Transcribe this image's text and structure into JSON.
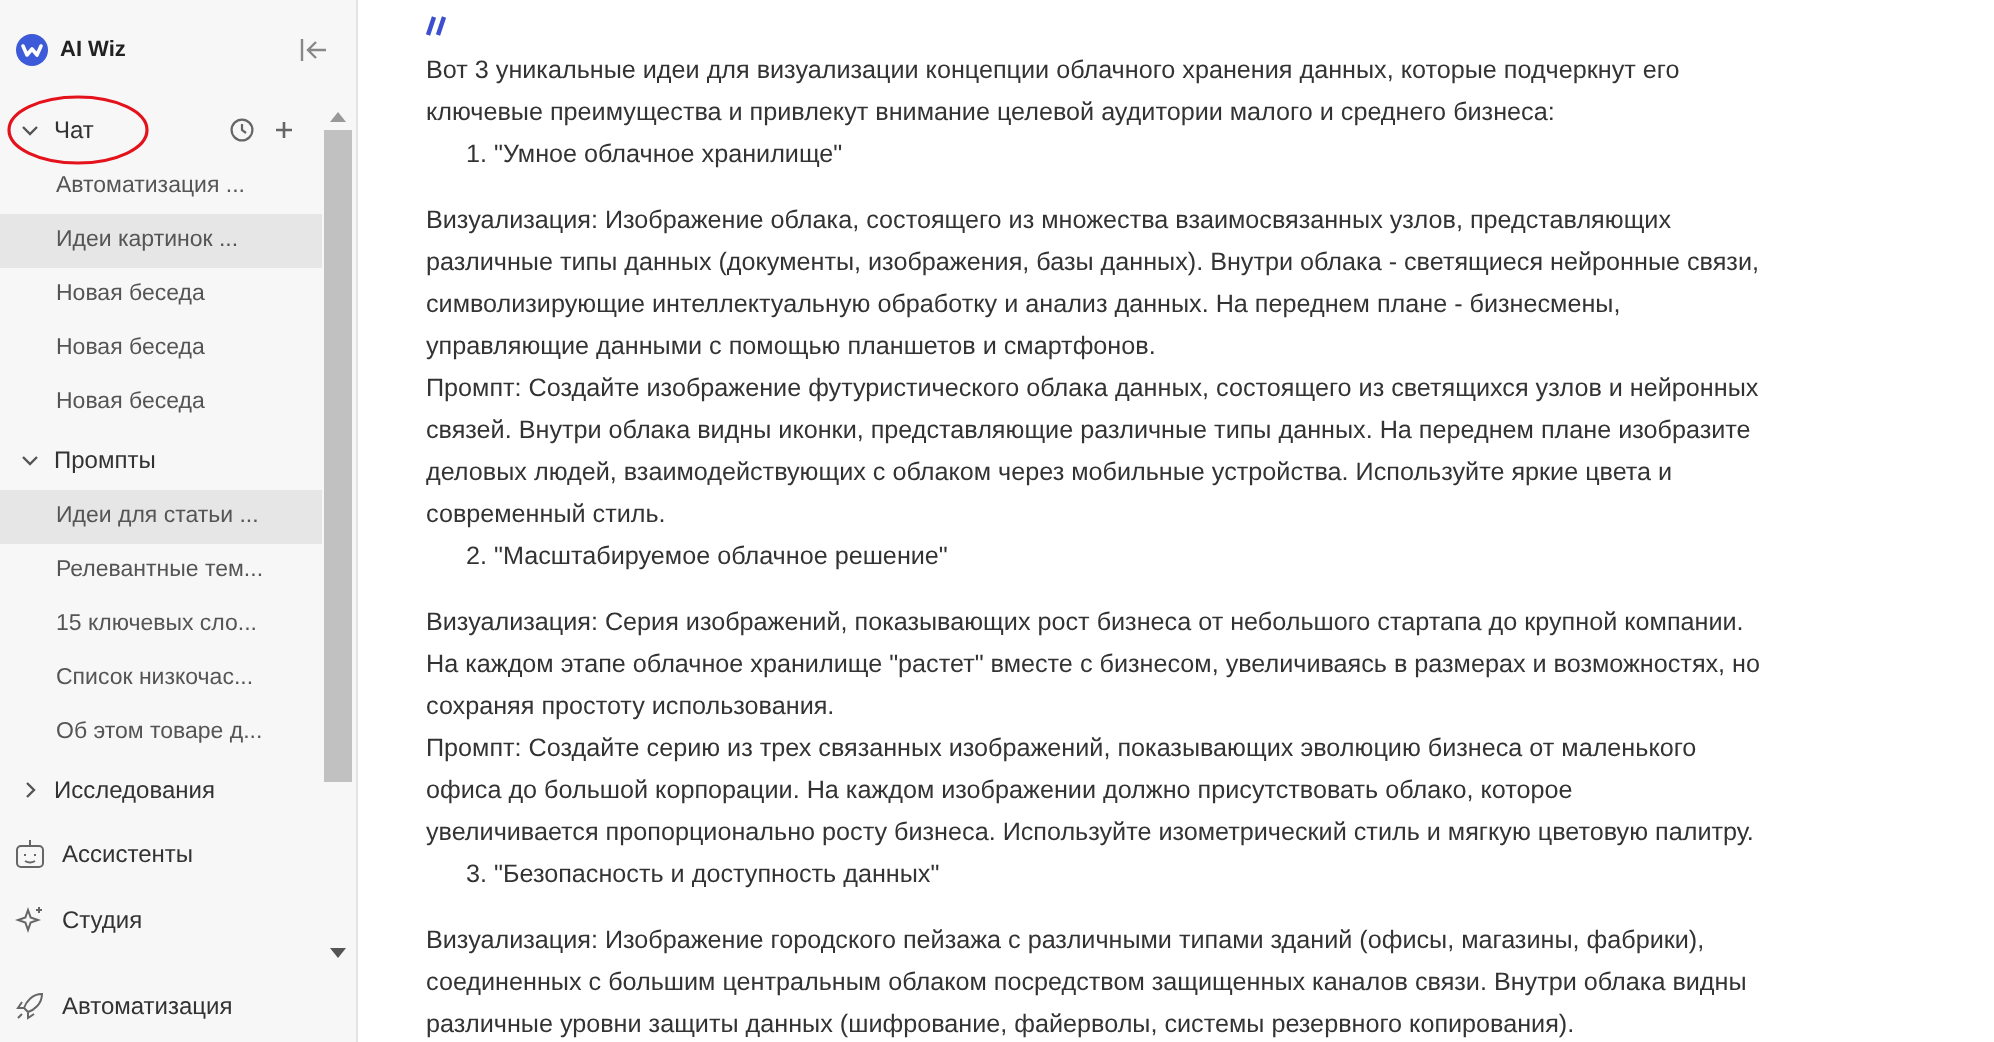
{
  "app": {
    "name": "AI Wiz"
  },
  "sidebar": {
    "groups": [
      {
        "kind": "group",
        "label": "Чат",
        "expanded": true,
        "actions": true,
        "items": [
          {
            "label": "Автоматизация ...",
            "selected": false
          },
          {
            "label": "Идеи картинок ...",
            "selected": true
          },
          {
            "label": "Новая беседа",
            "selected": false
          },
          {
            "label": "Новая беседа",
            "selected": false
          },
          {
            "label": "Новая беседа",
            "selected": false
          }
        ]
      },
      {
        "kind": "group",
        "label": "Промпты",
        "expanded": true,
        "actions": false,
        "items": [
          {
            "label": "Идеи для статьи ...",
            "selected": true
          },
          {
            "label": "Релевантные тем...",
            "selected": false
          },
          {
            "label": "15 ключевых сло...",
            "selected": false
          },
          {
            "label": "Список низкочас...",
            "selected": false
          },
          {
            "label": "Об этом товаре д...",
            "selected": false
          }
        ]
      },
      {
        "kind": "group",
        "label": "Исследования",
        "expanded": false,
        "actions": false
      },
      {
        "kind": "link",
        "label": "Ассистенты"
      },
      {
        "kind": "link",
        "label": "Студия"
      }
    ],
    "footer": {
      "label": "Автоматизация"
    }
  },
  "message": {
    "blocks": [
      {
        "kind": "paragraph",
        "text": "Вот 3 уникальные идеи для визуализации концепции облачного хранения данных, которые подчеркнут его\nключевые преимущества и привлекут внимание целевой аудитории малого и среднего бизнеса:"
      },
      {
        "kind": "list_item",
        "number": "1.",
        "text": "\"Умное облачное хранилище\""
      },
      {
        "kind": "paragraph",
        "text": "Визуализация: Изображение облака, состоящего из множества взаимосвязанных узлов, представляющих\nразличные типы данных (документы, изображения, базы данных). Внутри облака - светящиеся нейронные связи,\nсимволизирующие интеллектуальную обработку и анализ данных. На переднем плане - бизнесмены,\nуправляющие данными с помощью планшетов и смартфонов."
      },
      {
        "kind": "paragraph",
        "text": "Промпт: Создайте изображение футуристического облака данных, состоящего из светящихся узлов и нейронных\nсвязей. Внутри облака видны иконки, представляющие различные типы данных. На переднем плане изобразите\nделовых людей, взаимодействующих с облаком через мобильные устройства. Используйте яркие цвета и\nсовременный стиль."
      },
      {
        "kind": "list_item",
        "number": "2.",
        "text": "\"Масштабируемое облачное решение\""
      },
      {
        "kind": "paragraph",
        "text": "Визуализация: Серия изображений, показывающих рост бизнеса от небольшого стартапа до крупной компании.\nНа каждом этапе облачное хранилище \"растет\" вместе с бизнесом, увеличиваясь в размерах и возможностях, но\nсохраняя простоту использования."
      },
      {
        "kind": "paragraph",
        "text": "Промпт: Создайте серию из трех связанных изображений, показывающих эволюцию бизнеса от маленького\nофиса до большой корпорации. На каждом изображении должно присутствовать облако, которое\nувеличивается пропорционально росту бизнеса. Используйте изометрический стиль и мягкую цветовую палитру."
      },
      {
        "kind": "list_item",
        "number": "3.",
        "text": "\"Безопасность и доступность данных\""
      },
      {
        "kind": "paragraph",
        "text": "Визуализация: Изображение городского пейзажа с различными типами зданий (офисы, магазины, фабрики),\nсоединенных с большим центральным облаком посредством защищенных каналов связи. Внутри облака видны\nразличные уровни защиты данных (шифрование, файерволы, системы резервного копирования)."
      }
    ]
  }
}
